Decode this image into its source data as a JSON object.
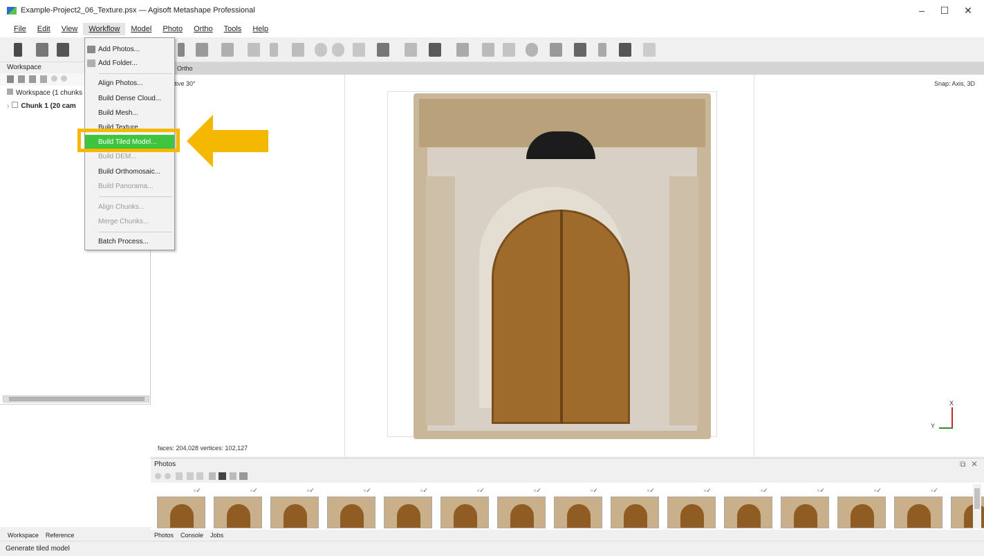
{
  "window": {
    "title": "Example-Project2_06_Texture.psx — Agisoft Metashape Professional",
    "minimize": "–",
    "maximize": "☐",
    "close": "✕"
  },
  "menubar": [
    "File",
    "Edit",
    "View",
    "Workflow",
    "Model",
    "Photo",
    "Ortho",
    "Tools",
    "Help"
  ],
  "workflow_menu": {
    "add_photos": "Add Photos...",
    "add_folder": "Add Folder...",
    "align_photos": "Align Photos...",
    "build_dense_cloud": "Build Dense Cloud...",
    "build_mesh": "Build Mesh...",
    "build_texture": "Build Texture...",
    "build_tiled_model": "Build Tiled Model...",
    "build_dem": "Build DEM...",
    "build_orthomosaic": "Build Orthomosaic...",
    "build_panorama": "Build Panorama...",
    "align_chunks": "Align Chunks...",
    "merge_chunks": "Merge Chunks...",
    "batch_process": "Batch Process..."
  },
  "workspace": {
    "title": "Workspace",
    "root": "Workspace (1 chunks",
    "chunk": "Chunk 1 (20 cam"
  },
  "view": {
    "tab_ortho": "Ortho",
    "perspective": "ctive 30°",
    "snap": "Snap: Axis, 3D",
    "stats": "faces: 204,028 vertices: 102,127",
    "axis_x": "X",
    "axis_y": "Y"
  },
  "photos": {
    "title": "Photos",
    "check": "▫✓"
  },
  "bottom_tabs_left": [
    "Workspace",
    "Reference"
  ],
  "bottom_tabs_right": [
    "Photos",
    "Console",
    "Jobs"
  ],
  "status": "Generate tiled model",
  "colors": {
    "highlight": "#3ec43e",
    "annotation": "#f5b800"
  }
}
